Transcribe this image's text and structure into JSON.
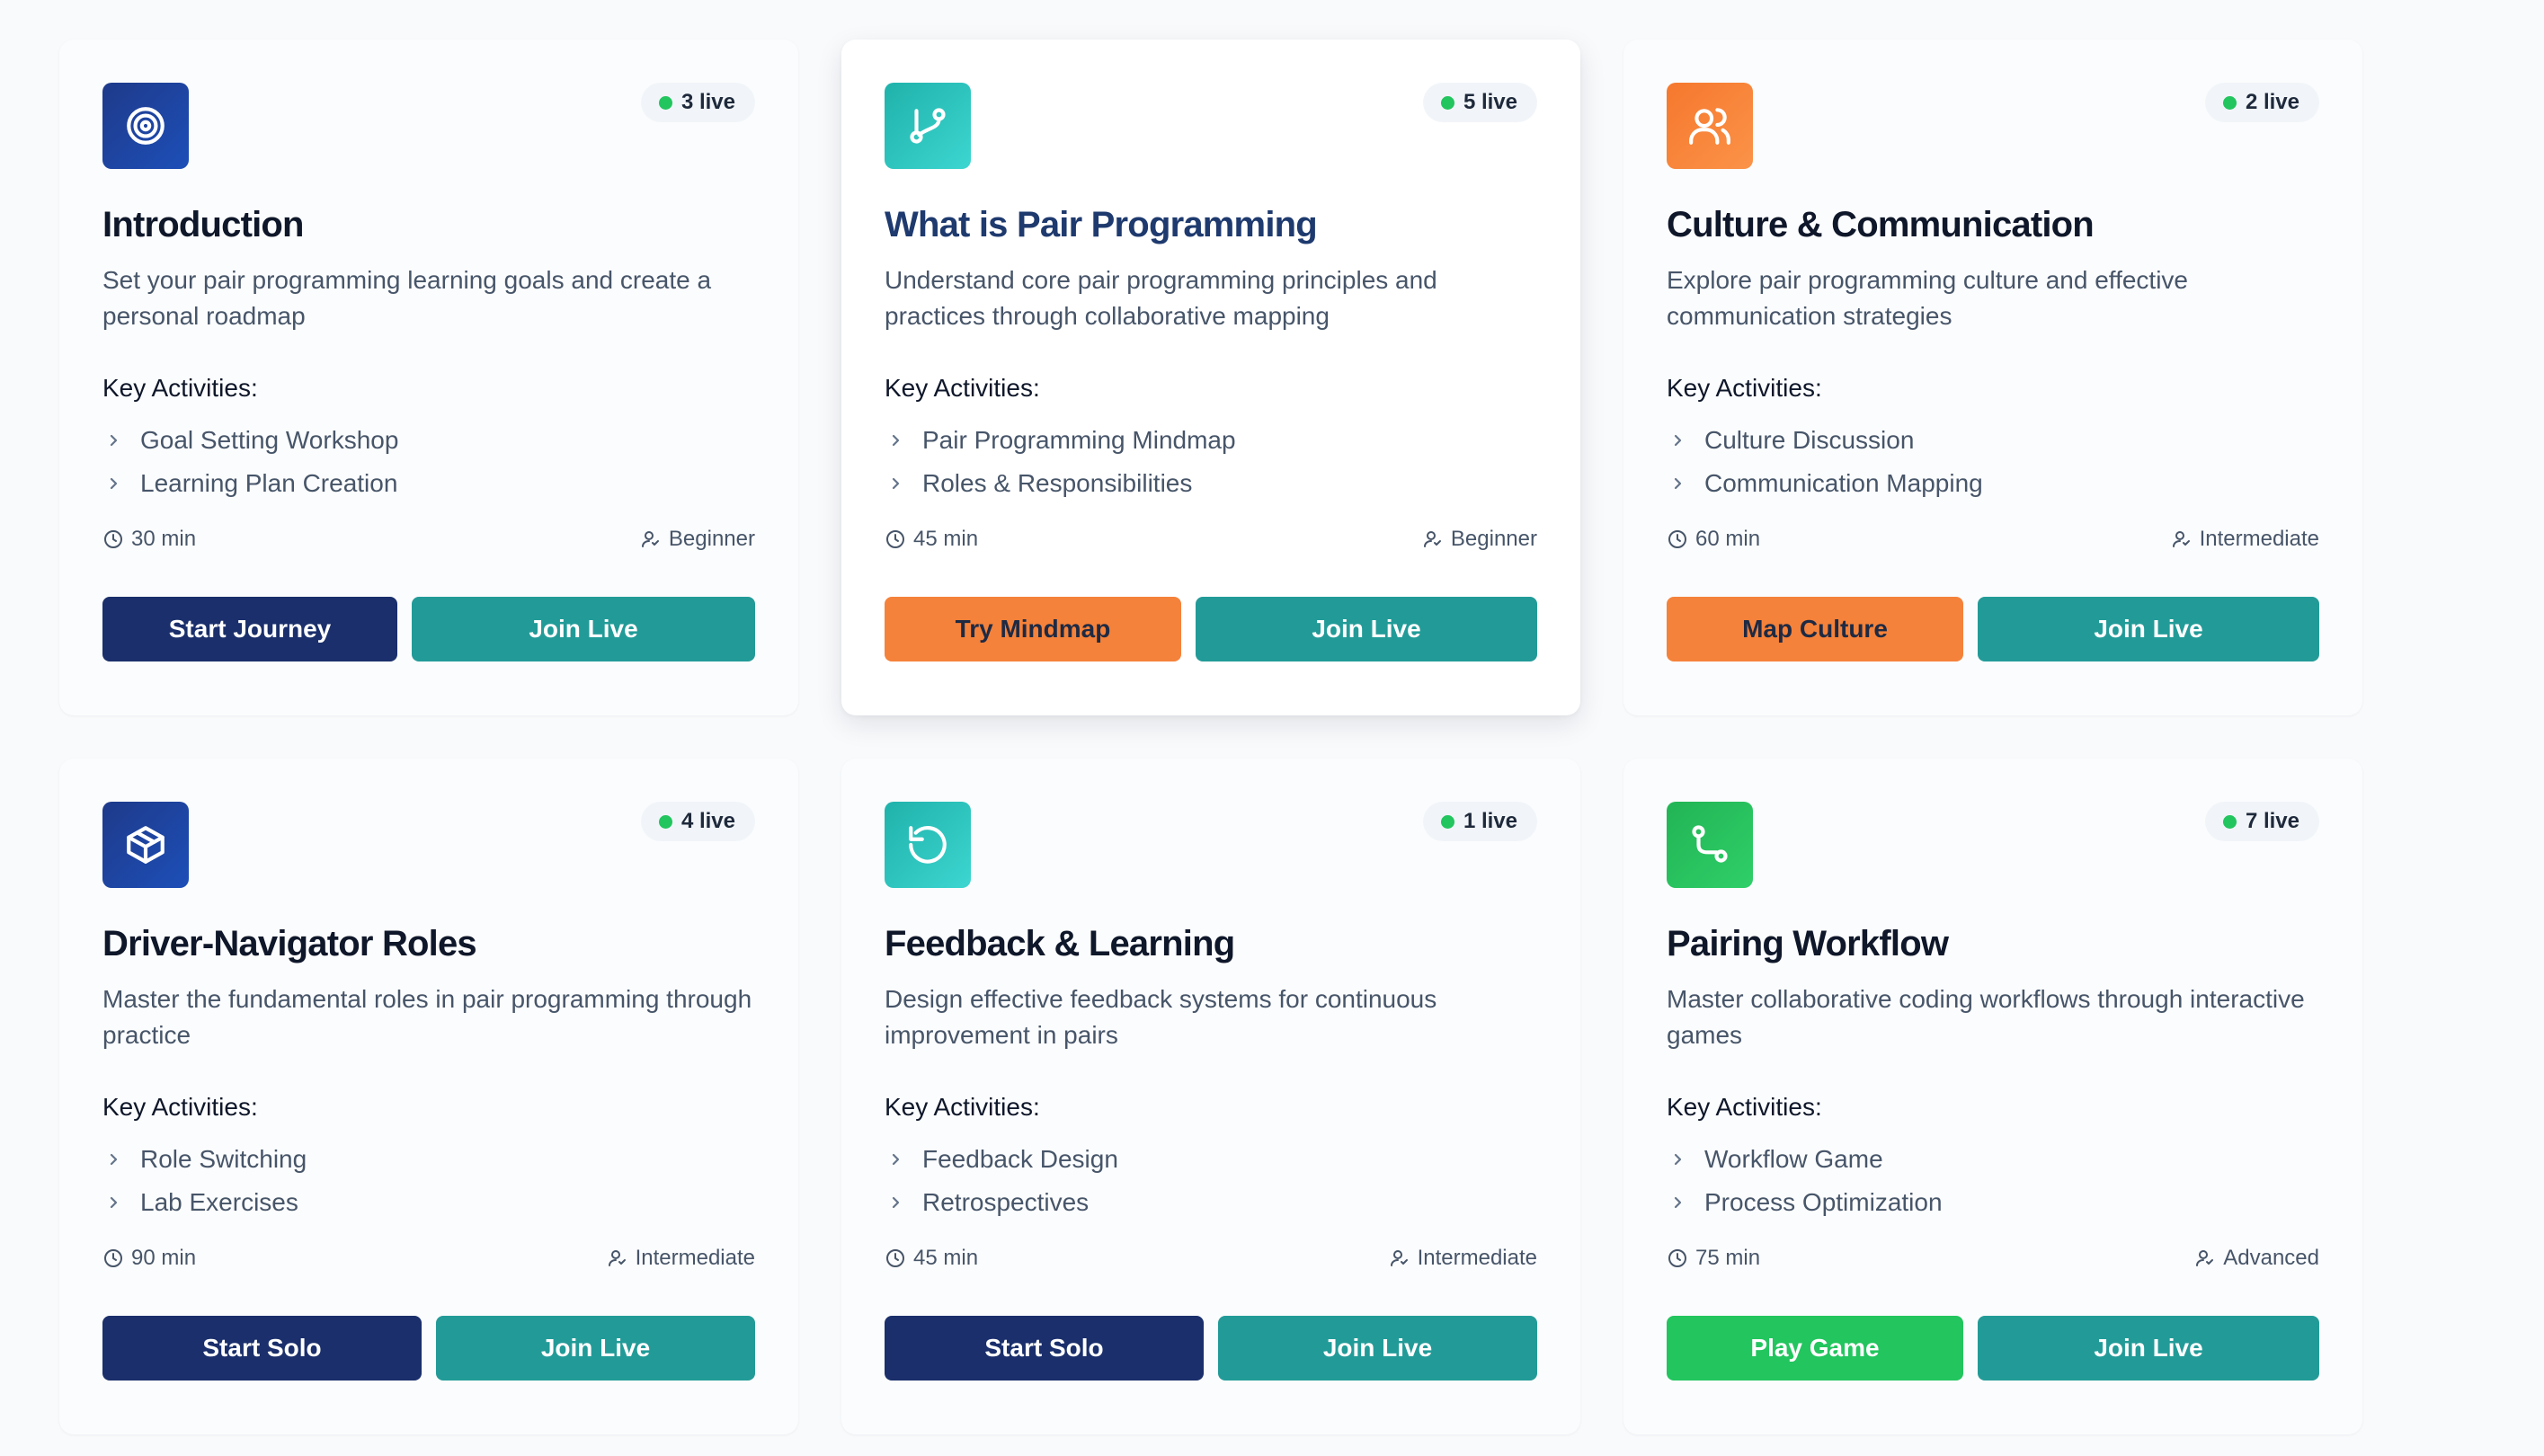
{
  "colors": {
    "page_background": "#f8fafc",
    "navy": "#1a2f6b",
    "teal": "#229b98",
    "orange": "#f5823a",
    "green": "#22c55e",
    "live_dot": "#22c55e"
  },
  "cards": [
    {
      "icon": "target-icon",
      "icon_bg": "linear-gradient(135deg, #1e3a8a, #1d4fb8)",
      "live_count": "3 live",
      "title": "Introduction",
      "description": "Set your pair programming learning goals and create a personal roadmap",
      "activities_label": "Key Activities:",
      "activities": [
        "Goal Setting Workshop",
        "Learning Plan Creation"
      ],
      "duration": "30 min",
      "level": "Beginner",
      "primary_button": "Start Journey",
      "primary_style": "btn-navy",
      "primary_width": 328,
      "secondary_button": "Join Live"
    },
    {
      "icon": "git-branch-icon",
      "icon_bg": "linear-gradient(135deg, #1fb2ab, #3dd6d0)",
      "live_count": "5 live",
      "title": "What is Pair Programming",
      "description": "Understand core pair programming principles and practices through collaborative mapping",
      "activities_label": "Key Activities:",
      "activities": [
        "Pair Programming Mindmap",
        "Roles & Responsibilities"
      ],
      "duration": "45 min",
      "level": "Beginner",
      "primary_button": "Try Mindmap",
      "primary_style": "btn-orange",
      "primary_width": 330,
      "secondary_button": "Join Live",
      "featured": true
    },
    {
      "icon": "users-icon",
      "icon_bg": "linear-gradient(135deg, #f5782e, #fb9348)",
      "live_count": "2 live",
      "title": "Culture & Communication",
      "description": "Explore pair programming culture and effective communication strategies",
      "activities_label": "Key Activities:",
      "activities": [
        "Culture Discussion",
        "Communication Mapping"
      ],
      "duration": "60 min",
      "level": "Intermediate",
      "primary_button": "Map Culture",
      "primary_style": "btn-orange",
      "primary_width": 330,
      "secondary_button": "Join Live"
    },
    {
      "icon": "box-icon",
      "icon_bg": "linear-gradient(135deg, #1e3a8a, #1d4fb8)",
      "live_count": "4 live",
      "title": "Driver-Navigator Roles",
      "description": "Master the fundamental roles in pair programming through practice",
      "activities_label": "Key Activities:",
      "activities": [
        "Role Switching",
        "Lab Exercises"
      ],
      "duration": "90 min",
      "level": "Intermediate",
      "primary_button": "Start Solo",
      "primary_style": "btn-navy",
      "primary_width": 355,
      "secondary_button": "Join Live"
    },
    {
      "icon": "rotate-ccw-icon",
      "icon_bg": "linear-gradient(135deg, #1fb2ab, #3dd6d0)",
      "live_count": "1 live",
      "title": "Feedback & Learning",
      "description": "Design effective feedback systems for continuous improvement in pairs",
      "activities_label": "Key Activities:",
      "activities": [
        "Feedback Design",
        "Retrospectives"
      ],
      "duration": "45 min",
      "level": "Intermediate",
      "primary_button": "Start Solo",
      "primary_style": "btn-navy",
      "primary_width": 355,
      "secondary_button": "Join Live"
    },
    {
      "icon": "route-icon",
      "icon_bg": "linear-gradient(135deg, #22b455, #2fcf69)",
      "live_count": "7 live",
      "title": "Pairing Workflow",
      "description": "Master collaborative coding workflows through interactive games",
      "activities_label": "Key Activities:",
      "activities": [
        "Workflow Game",
        "Process Optimization"
      ],
      "duration": "75 min",
      "level": "Advanced",
      "primary_button": "Play Game",
      "primary_style": "btn-green",
      "primary_width": 330,
      "secondary_button": "Join Live"
    }
  ]
}
